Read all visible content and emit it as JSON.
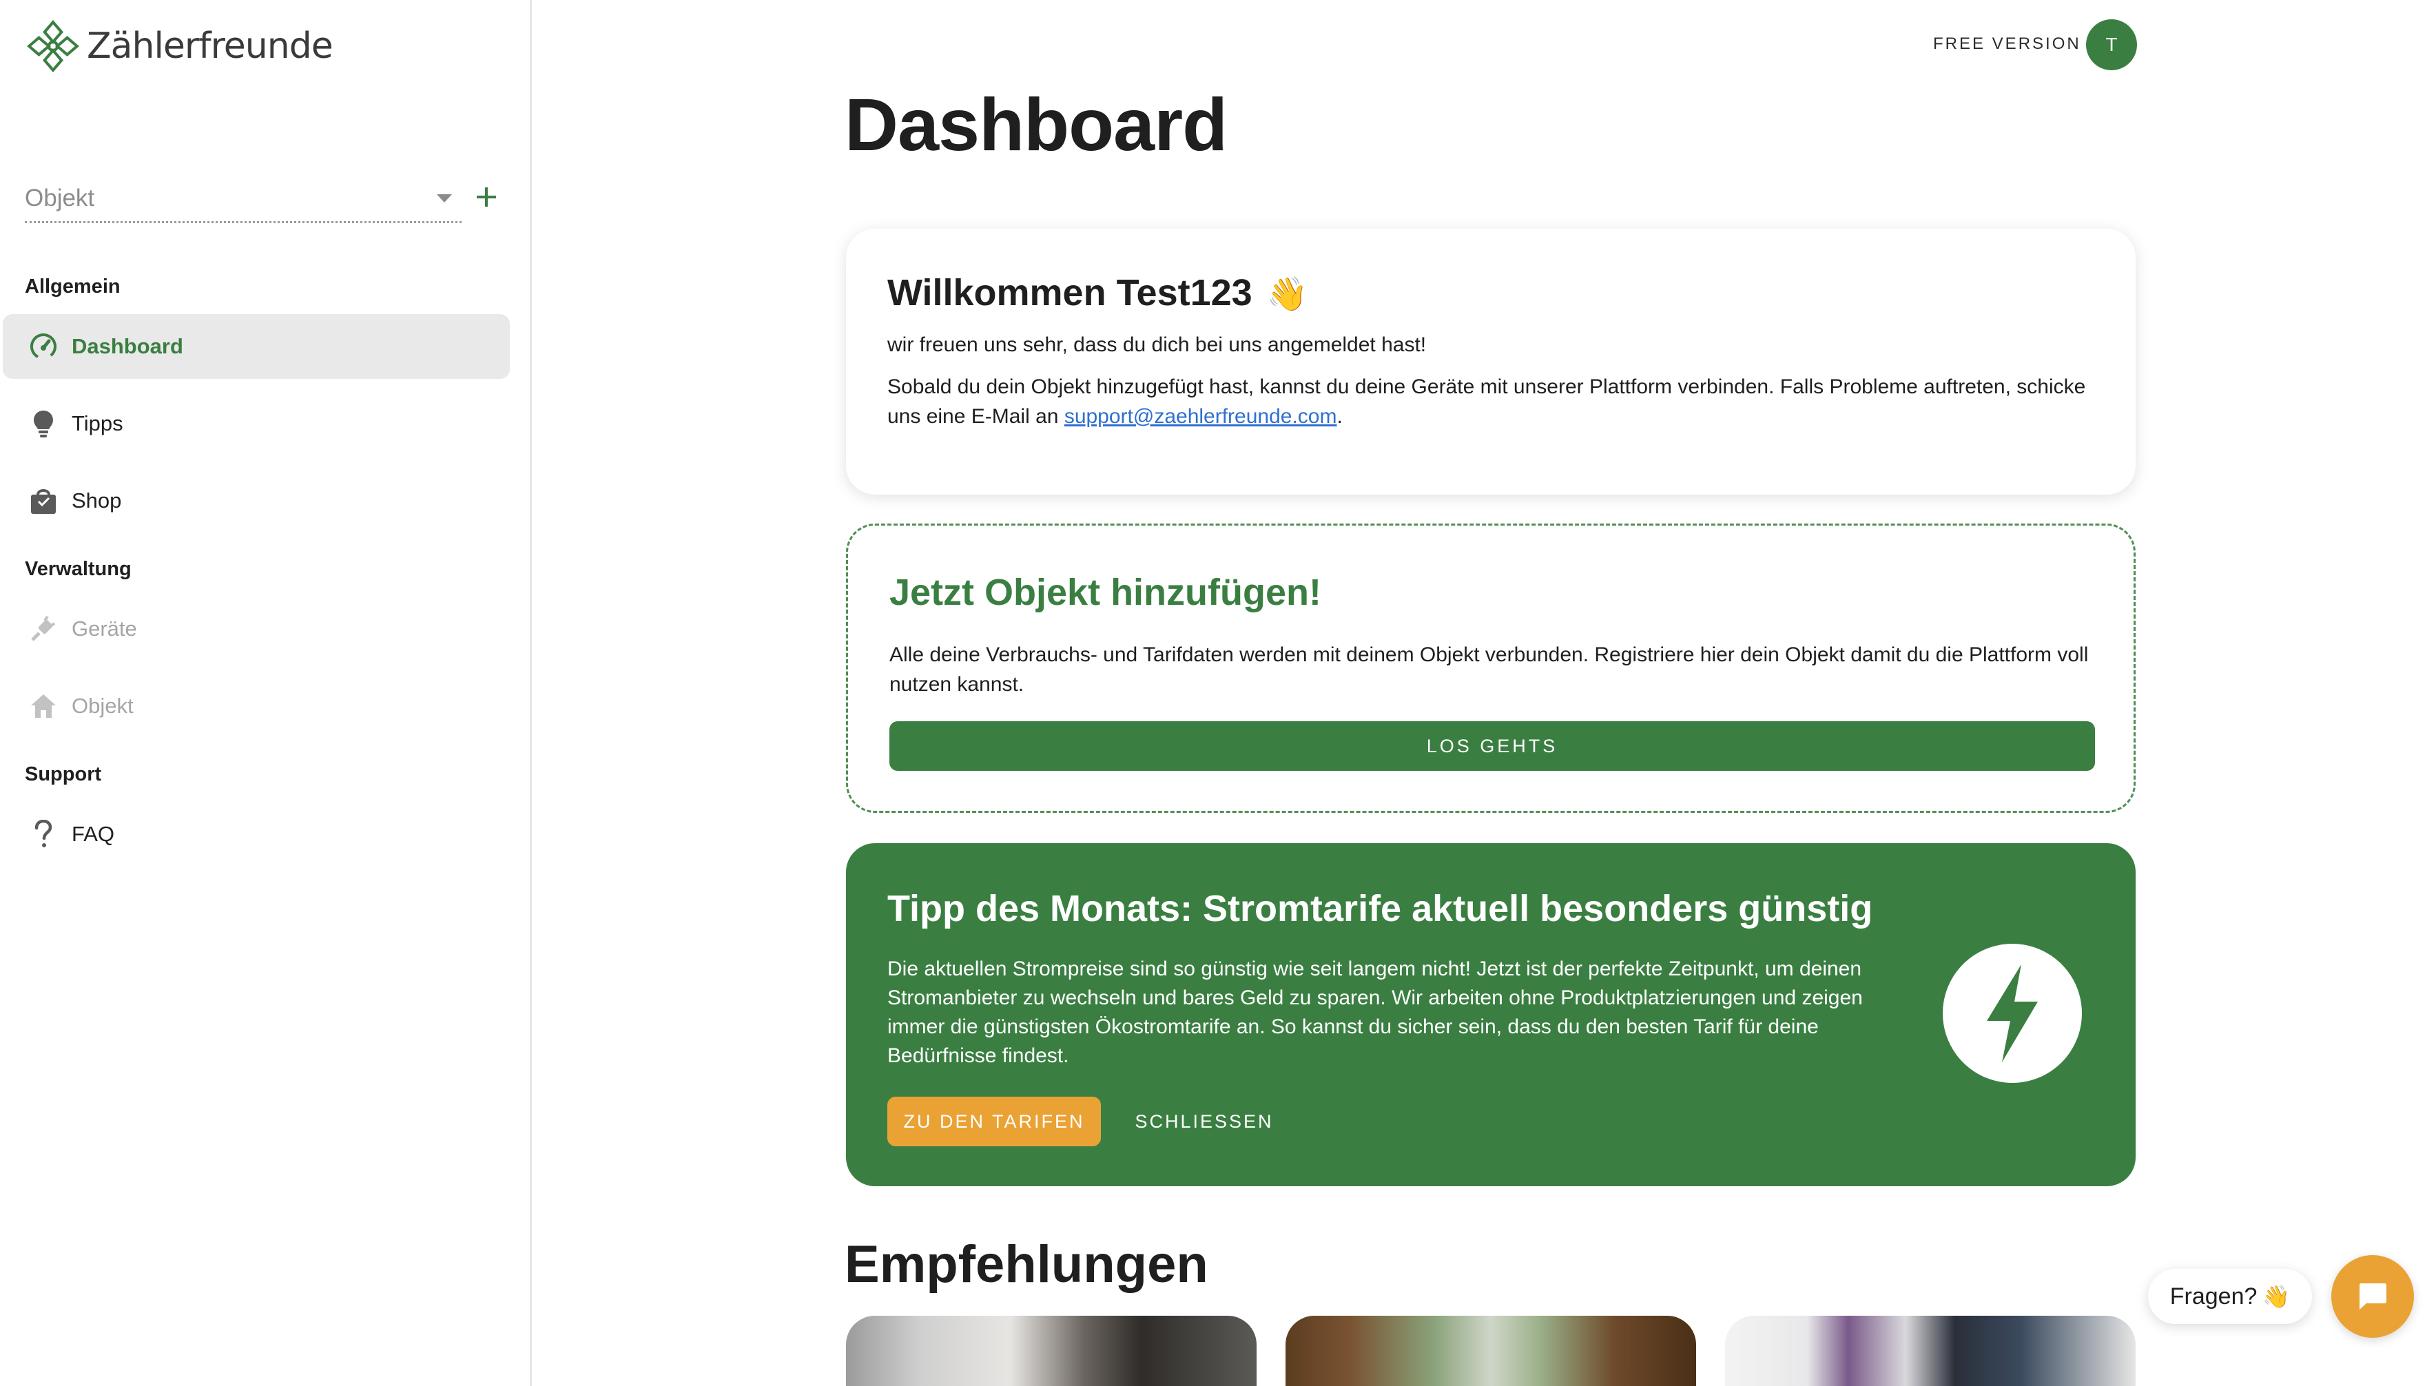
{
  "app": {
    "logo_text": "Zählerfreunde",
    "accent_color": "#3a7f41",
    "warning_color": "#eaa235"
  },
  "sidebar": {
    "object_select_placeholder": "Objekt",
    "sections": {
      "general": "Allgemein",
      "management": "Verwaltung",
      "support": "Support"
    },
    "items": [
      {
        "label": "Dashboard",
        "icon": "speedometer-icon",
        "active": true
      },
      {
        "label": "Tipps",
        "icon": "lightbulb-icon"
      },
      {
        "label": "Shop",
        "icon": "shopping-bag-icon"
      },
      {
        "label": "Geräte",
        "icon": "plug-icon",
        "disabled": true
      },
      {
        "label": "Objekt",
        "icon": "home-icon",
        "disabled": true
      },
      {
        "label": "FAQ",
        "icon": "question-icon"
      }
    ]
  },
  "header": {
    "plan_label": "FREE VERSION",
    "avatar_initial": "T"
  },
  "page": {
    "title": "Dashboard"
  },
  "welcome": {
    "title": "Willkommen Test123",
    "emoji": "👋",
    "line1": "wir freuen uns sehr, dass du dich bei uns angemeldet hast!",
    "line2_prefix": "Sobald du dein Objekt hinzugefügt hast, kannst du deine Geräte mit unserer Plattform verbinden. Falls Probleme auftreten, schicke uns eine E-Mail an ",
    "email": "support@zaehlerfreunde.com",
    "line2_suffix": "."
  },
  "add_object": {
    "title": "Jetzt Objekt hinzufügen!",
    "text": "Alle deine Verbrauchs- und Tarifdaten werden mit deinem Objekt verbunden. Registriere hier dein Objekt damit du die Plattform voll nutzen kannst.",
    "button": "LOS GEHTS"
  },
  "tip": {
    "title": "Tipp des Monats: Stromtarife aktuell besonders günstig",
    "text": "Die aktuellen Strompreise sind so günstig wie seit langem nicht! Jetzt ist der perfekte Zeitpunkt, um deinen Stromanbieter zu wechseln und bares Geld zu sparen. Wir arbeiten ohne Produktplatzierungen und zeigen immer die günstigsten Ökostromtarife an. So kannst du sicher sein, dass du den besten Tarif für deine Bedürfnisse findest.",
    "primary_button": "ZU DEN TARIFEN",
    "secondary_button": "SCHLIESSEN",
    "icon": "lightning-bolt-icon"
  },
  "recommendations": {
    "title": "Empfehlungen"
  },
  "chat": {
    "prompt": "Fragen?",
    "emoji": "👋"
  }
}
